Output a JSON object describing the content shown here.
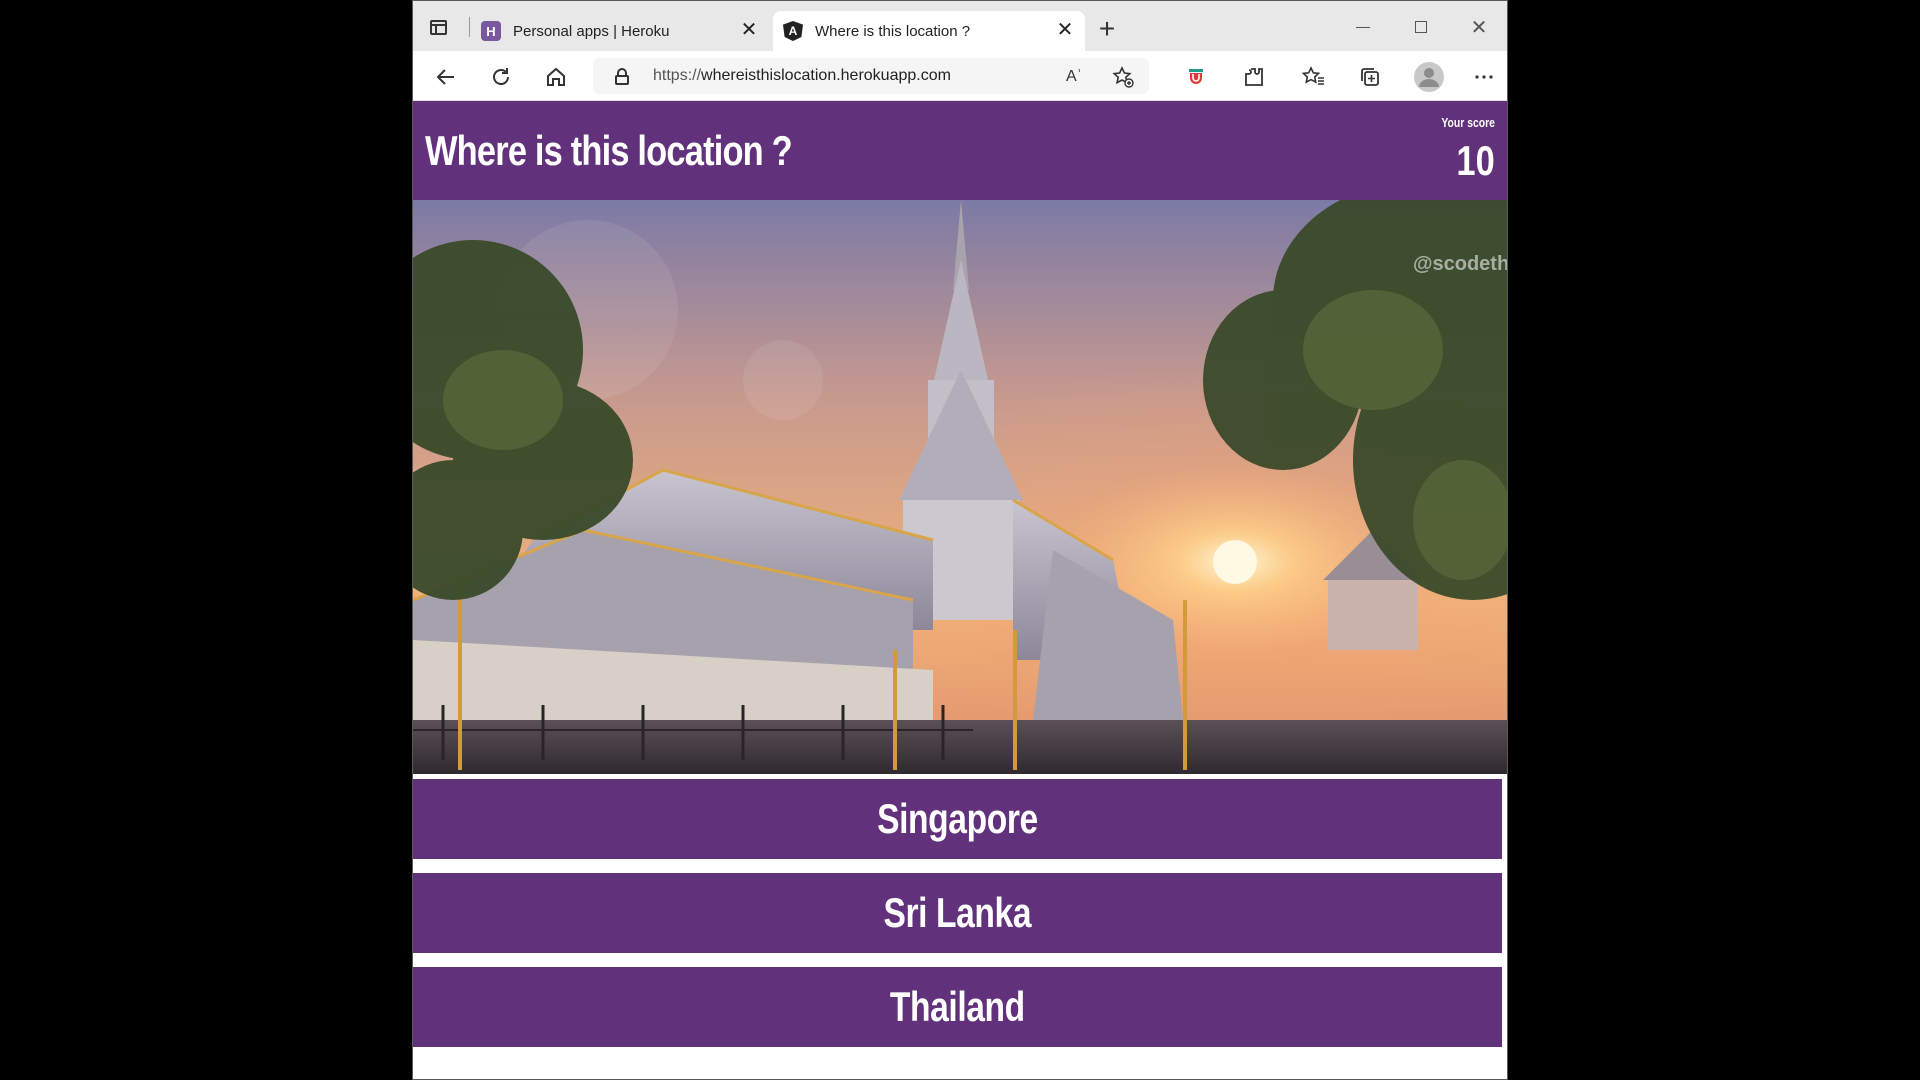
{
  "browser": {
    "tabs": [
      {
        "favicon": "H",
        "title": "Personal apps | Heroku"
      },
      {
        "favicon": "A",
        "title": "Where is this location ?"
      }
    ],
    "url_protocol": "https://",
    "url_host": "whereisthislocation.herokuapp.com",
    "read_aloud_label": "Aʾ",
    "window_controls": {
      "close": "✕"
    }
  },
  "app": {
    "title": "Where is this location ?",
    "score_label": "Your score",
    "score": "10",
    "photo_watermark": "@scodeth",
    "answers": [
      "Singapore",
      "Sri Lanka",
      "Thailand"
    ]
  },
  "colors": {
    "accent": "#62317b",
    "page_bg": "#ffffff"
  }
}
